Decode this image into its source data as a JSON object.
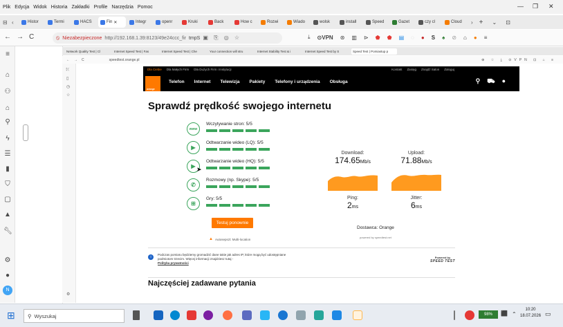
{
  "browser": {
    "menu": [
      "Plik",
      "Edycja",
      "Widok",
      "Historia",
      "Zakładki",
      "Profile",
      "Narzędzia",
      "Pomoc"
    ],
    "window_controls": {
      "minimize": "—",
      "maximize": "❐",
      "close": "✕"
    },
    "tabs": [
      {
        "label": "Histor",
        "color": "#3b78e7"
      },
      {
        "label": "Termi",
        "color": "#3b78e7"
      },
      {
        "label": "HACS",
        "color": "#3b78e7"
      },
      {
        "label": "Fin",
        "color": "#3b78e7",
        "active": true
      },
      {
        "label": "Integr",
        "color": "#3b78e7"
      },
      {
        "label": "openr",
        "color": "#3b78e7"
      },
      {
        "label": "Kruki",
        "color": "#e53935"
      },
      {
        "label": "Back",
        "color": "#e53935"
      },
      {
        "label": "How c",
        "color": "#e53935"
      },
      {
        "label": "Rozwi",
        "color": "#f57c00"
      },
      {
        "label": "Wiado",
        "color": "#f57c00"
      },
      {
        "label": "wolsk",
        "color": "#555"
      },
      {
        "label": "install",
        "color": "#555"
      },
      {
        "label": "Speed",
        "color": "#555"
      },
      {
        "label": "Gazet",
        "color": "#2e7d32"
      },
      {
        "label": "czy cl",
        "color": "#555"
      },
      {
        "label": "Cloud",
        "color": "#f57c00"
      }
    ],
    "tab_new": "+",
    "nav": {
      "back": "←",
      "forward": "→",
      "reload": "C"
    },
    "url": {
      "security": "Niezabezpieczone",
      "text": "http://192.168.1.39:8123/49e24ccc_fir",
      "extra": "tmpS"
    },
    "toolbar_right": [
      "VPN"
    ]
  },
  "inner_browser": {
    "tabs": [
      "Network Quality Test | Cl",
      "Internet Speed Test | Fas",
      "Internet Speed Test | Che",
      "Your connection will stru",
      "Internet Stability Test & i",
      "Internet Speed Test by S",
      "Speed Test | Pomiastup p"
    ],
    "url": "speedtest.orange.pl"
  },
  "site": {
    "topnav": [
      "Dla Ciebie",
      "Dla Małych Firm",
      "Dla Dużych Firm i Instytucji"
    ],
    "topnav_right": [
      "Kontakt",
      "Zasięg",
      "Znajdź Salon",
      "Zaloguj"
    ],
    "logo_text": "orange",
    "mainnav": [
      "Telefon",
      "Internet",
      "Telewizja",
      "Pakiety",
      "Telefony i urządzenia",
      "Obsługa"
    ],
    "title": "Sprawdź prędkość swojego internetu",
    "quality": [
      {
        "label": "Wczytywanie stron: 5/5",
        "icon": "www-icon"
      },
      {
        "label": "Odtwarzanie wideo (LQ): 5/5",
        "icon": "play-icon"
      },
      {
        "label": "Odtwarzanie wideo (HQ): 5/5",
        "icon": "play-icon"
      },
      {
        "label": "Rozmowy (np. Skype): 5/5",
        "icon": "phone-icon"
      },
      {
        "label": "Gry: 5/5",
        "icon": "gamepad-icon"
      }
    ],
    "download": {
      "label": "Download:",
      "value": "174.65",
      "unit": "Mb/s"
    },
    "upload": {
      "label": "Upload:",
      "value": "71.88",
      "unit": "Mb/s"
    },
    "ping": {
      "label": "Ping:",
      "value": "2",
      "unit": "ms"
    },
    "jitter": {
      "label": "Jitter:",
      "value": "6",
      "unit": "ms"
    },
    "retest": "Testuj ponownie",
    "multilocation": "Autosepszt: Multi-location",
    "provider": "Dostawca: Orange",
    "powered_small": "powered by speedtest.net",
    "privacy": "Podczas pomiaru będziemy gromadzić dane takie jak adres IP, które mogą być udostępniane podmiotom trzecim. Więcej informacji znajdziesz tutaj -",
    "privacy_link": "Polityka prywatności",
    "powered_by": "Powered by",
    "powered_logo": "SPEED TEST",
    "faq": "Najczęściej zadawane pytania",
    "accent": "#ff7900",
    "green": "#3ba55c"
  },
  "taskbar": {
    "search": "Wyszukaj",
    "battery": "98%",
    "time": "10:20",
    "date": "18.07.2026"
  }
}
